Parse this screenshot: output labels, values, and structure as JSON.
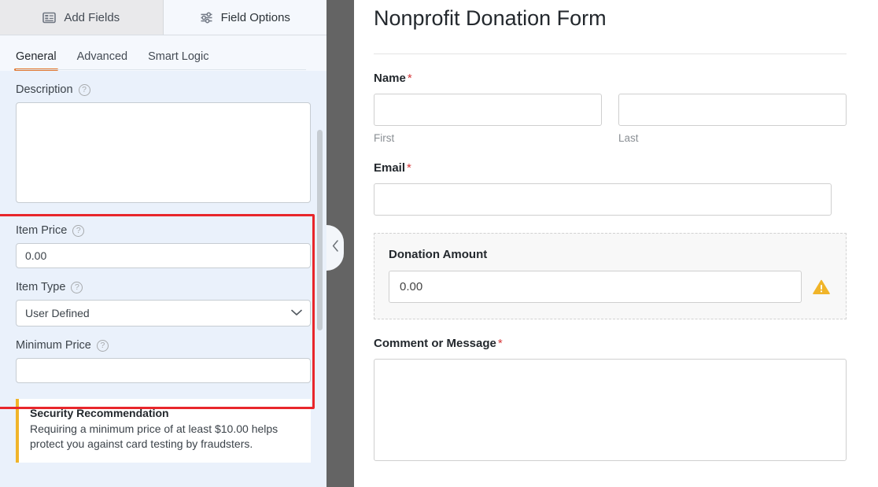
{
  "left_panel": {
    "top_tabs": [
      {
        "label": "Add Fields",
        "icon": "form-list-icon",
        "active": false
      },
      {
        "label": "Field Options",
        "icon": "sliders-icon",
        "active": true
      }
    ],
    "sub_tabs": [
      {
        "label": "General",
        "active": true
      },
      {
        "label": "Advanced",
        "active": false
      },
      {
        "label": "Smart Logic",
        "active": false
      }
    ],
    "fields": {
      "description": {
        "label": "Description",
        "help": "?",
        "value": ""
      },
      "item_price": {
        "label": "Item Price",
        "help": "?",
        "value": "0.00"
      },
      "item_type": {
        "label": "Item Type",
        "help": "?",
        "value": "User Defined"
      },
      "minimum_price": {
        "label": "Minimum Price",
        "help": "?",
        "value": ""
      }
    },
    "security_note": {
      "title": "Security Recommendation",
      "text": "Requiring a minimum price of at least $10.00 helps protect you against card testing by fraudsters."
    },
    "highlight_color": "#e8262b",
    "accent_color": "#e27730"
  },
  "divider": {
    "collapse_label": "‹"
  },
  "preview": {
    "form_title": "Nonprofit Donation Form",
    "fields": [
      {
        "label": "Name",
        "required": "*",
        "type": "name",
        "sublabels": [
          "First",
          "Last"
        ]
      },
      {
        "label": "Email",
        "required": "*",
        "type": "text"
      },
      {
        "label": "Donation Amount",
        "required": "",
        "type": "amount",
        "value": "0.00",
        "warning_icon": "warning-triangle-icon",
        "active": true
      },
      {
        "label": "Comment or Message",
        "required": "*",
        "type": "textarea"
      }
    ],
    "required_color": "#d63638",
    "warning_color": "#f0b429"
  }
}
